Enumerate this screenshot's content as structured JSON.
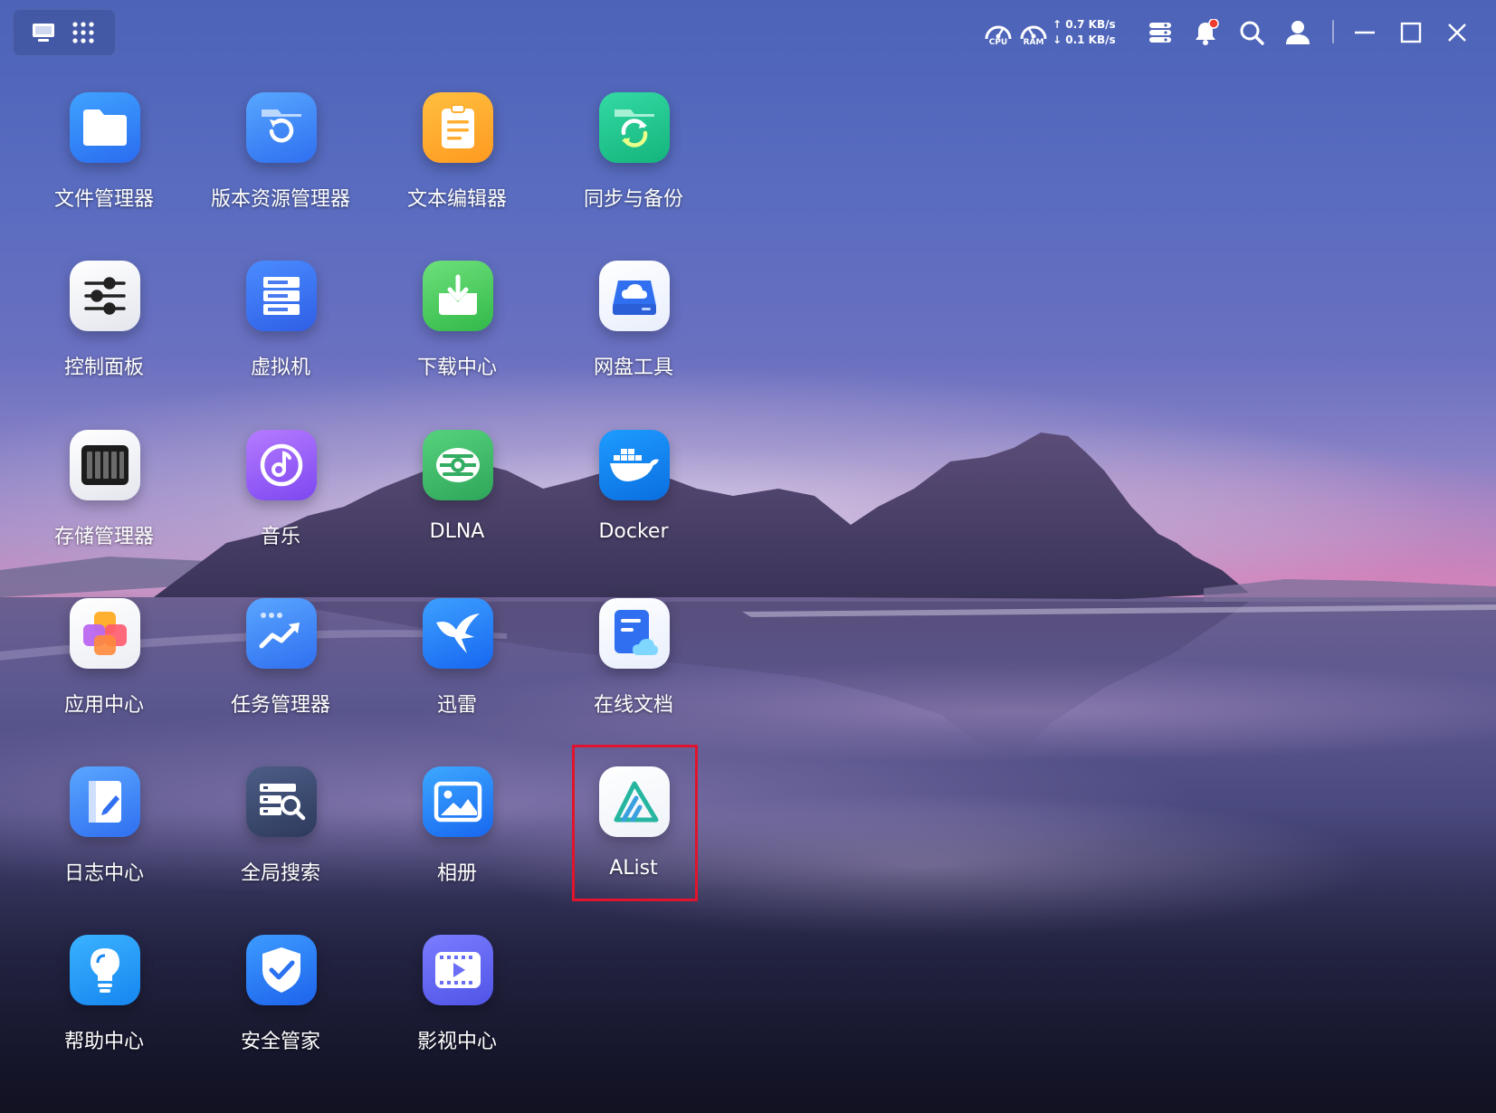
{
  "topbar": {
    "switcher": [
      {
        "icon": "desktop-icon"
      },
      {
        "icon": "app-grid-icon"
      }
    ],
    "cpu_label": "CPU",
    "ram_label": "RAM",
    "net_up": "↑ 0.7 KB/s",
    "net_down": "↓ 0.1 KB/s",
    "tray_icons": [
      "widgets-icon",
      "notification-bell-icon",
      "search-icon",
      "user-icon",
      "minimize-icon",
      "maximize-icon",
      "close-icon"
    ],
    "notification_dot_color": "#f03c2e"
  },
  "apps": [
    {
      "label": "文件管理器",
      "icon": "folder-icon"
    },
    {
      "label": "版本资源管理器",
      "icon": "version-folder-icon"
    },
    {
      "label": "文本编辑器",
      "icon": "text-editor-icon"
    },
    {
      "label": "同步与备份",
      "icon": "sync-backup-icon"
    },
    {
      "label": "控制面板",
      "icon": "control-panel-icon"
    },
    {
      "label": "虚拟机",
      "icon": "virtual-machine-icon"
    },
    {
      "label": "下载中心",
      "icon": "download-center-icon"
    },
    {
      "label": "网盘工具",
      "icon": "cloud-drive-icon"
    },
    {
      "label": "存储管理器",
      "icon": "storage-manager-icon"
    },
    {
      "label": "音乐",
      "icon": "music-icon"
    },
    {
      "label": "DLNA",
      "icon": "dlna-icon"
    },
    {
      "label": "Docker",
      "icon": "docker-icon"
    },
    {
      "label": "应用中心",
      "icon": "app-center-icon"
    },
    {
      "label": "任务管理器",
      "icon": "task-manager-icon"
    },
    {
      "label": "迅雷",
      "icon": "xunlei-icon"
    },
    {
      "label": "在线文档",
      "icon": "online-docs-icon"
    },
    {
      "label": "日志中心",
      "icon": "log-center-icon"
    },
    {
      "label": "全局搜索",
      "icon": "global-search-icon"
    },
    {
      "label": "相册",
      "icon": "photo-album-icon"
    },
    {
      "label": "AList",
      "icon": "alist-icon",
      "highlighted": true
    },
    {
      "label": "帮助中心",
      "icon": "help-center-icon"
    },
    {
      "label": "安全管家",
      "icon": "security-icon"
    },
    {
      "label": "影视中心",
      "icon": "video-center-icon"
    }
  ],
  "colors": {
    "highlight_border": "#e0142c",
    "label_text": "#ffffff"
  }
}
